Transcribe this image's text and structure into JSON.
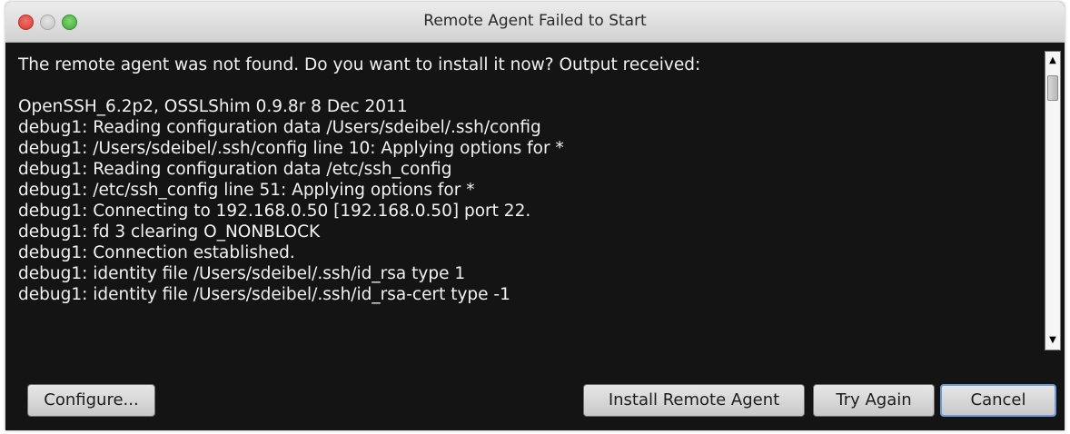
{
  "window": {
    "title": "Remote Agent Failed to Start"
  },
  "output": {
    "intro": "The remote agent was not found. Do you want to install it now? Output received:",
    "lines": [
      "OpenSSH_6.2p2, OSSLShim 0.9.8r 8 Dec 2011",
      "debug1: Reading configuration data /Users/sdeibel/.ssh/config",
      "debug1: /Users/sdeibel/.ssh/config line 10: Applying options for *",
      "debug1: Reading configuration data /etc/ssh_config",
      "debug1: /etc/ssh_config line 51: Applying options for *",
      "debug1: Connecting to 192.168.0.50 [192.168.0.50] port 22.",
      "debug1: fd 3 clearing O_NONBLOCK",
      "debug1: Connection established.",
      "debug1: identity file /Users/sdeibel/.ssh/id_rsa type 1",
      "debug1: identity file /Users/sdeibel/.ssh/id_rsa-cert type -1"
    ]
  },
  "buttons": {
    "configure": "Configure...",
    "install": "Install Remote Agent",
    "try_again": "Try Again",
    "cancel": "Cancel"
  },
  "icons": {
    "close": "close-window-icon",
    "minimize": "minimize-window-icon",
    "zoom": "zoom-window-icon",
    "scroll_up": "scroll-up-arrow-icon",
    "scroll_down": "scroll-down-arrow-icon"
  },
  "colors": {
    "background": "#141414",
    "text": "#f2f2f2",
    "default_button_border": "#6a9cd8"
  }
}
